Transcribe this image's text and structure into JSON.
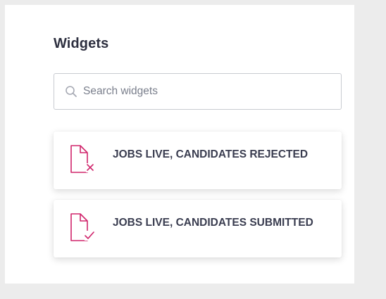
{
  "panel": {
    "title": "Widgets"
  },
  "search": {
    "placeholder": "Search widgets",
    "value": "",
    "icon": "search-icon"
  },
  "widgets": [
    {
      "label": "JOBS LIVE, CANDIDATES REJECTED",
      "icon": "document-x-icon",
      "icon_color": "#d0256c"
    },
    {
      "label": "JOBS LIVE, CANDIDATES SUBMITTED",
      "icon": "document-check-icon",
      "icon_color": "#d0256c"
    }
  ]
}
